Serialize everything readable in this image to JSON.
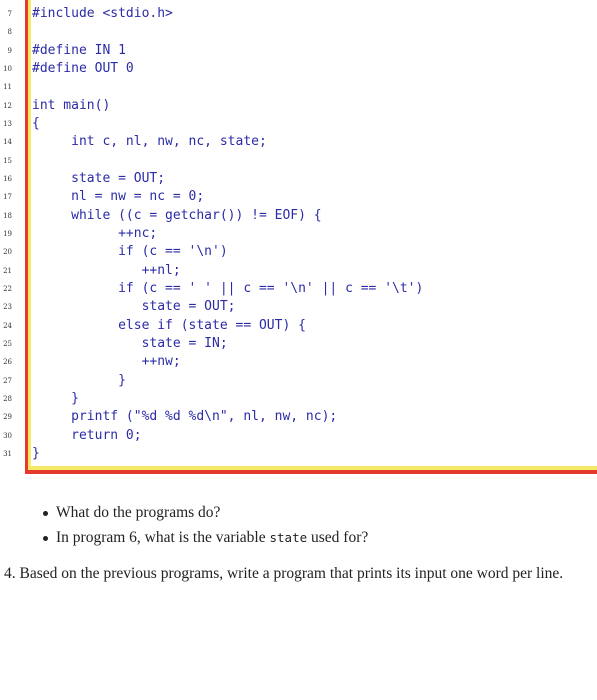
{
  "code": {
    "lines": [
      {
        "num": "7",
        "text": "#include <stdio.h>"
      },
      {
        "num": "8",
        "text": ""
      },
      {
        "num": "9",
        "text": "#define IN 1"
      },
      {
        "num": "10",
        "text": "#define OUT 0"
      },
      {
        "num": "11",
        "text": ""
      },
      {
        "num": "12",
        "text": "int main()"
      },
      {
        "num": "13",
        "text": "{"
      },
      {
        "num": "14",
        "text": "     int c, nl, nw, nc, state;"
      },
      {
        "num": "15",
        "text": ""
      },
      {
        "num": "16",
        "text": "     state = OUT;"
      },
      {
        "num": "17",
        "text": "     nl = nw = nc = 0;"
      },
      {
        "num": "18",
        "text": "     while ((c = getchar()) != EOF) {"
      },
      {
        "num": "19",
        "text": "           ++nc;"
      },
      {
        "num": "20",
        "text": "           if (c == '\\n')"
      },
      {
        "num": "21",
        "text": "              ++nl;"
      },
      {
        "num": "22",
        "text": "           if (c == ' ' || c == '\\n' || c == '\\t')"
      },
      {
        "num": "23",
        "text": "              state = OUT;"
      },
      {
        "num": "24",
        "text": "           else if (state == OUT) {"
      },
      {
        "num": "25",
        "text": "              state = IN;"
      },
      {
        "num": "26",
        "text": "              ++nw;"
      },
      {
        "num": "27",
        "text": "           }"
      },
      {
        "num": "28",
        "text": "     }"
      },
      {
        "num": "29",
        "text": "     printf (\"%d %d %d\\n\", nl, nw, nc);"
      },
      {
        "num": "30",
        "text": "     return 0;"
      },
      {
        "num": "31",
        "text": "}"
      }
    ]
  },
  "bullets": {
    "b1": "What do the programs do?",
    "b2_pre": "In program 6, what is the variable ",
    "b2_code": "state",
    "b2_post": " used for?"
  },
  "question4": "4. Based on the previous programs, write a program that prints its input one word per line."
}
